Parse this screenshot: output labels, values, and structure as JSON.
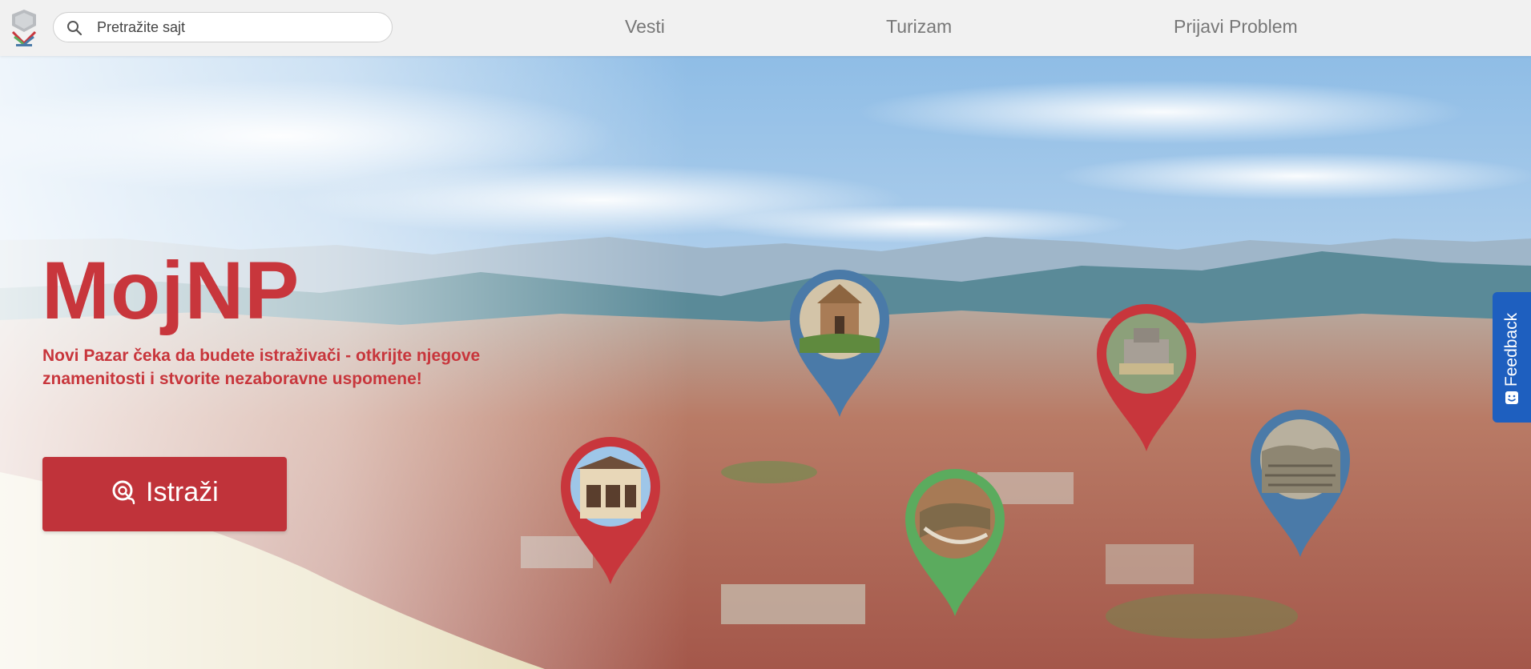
{
  "header": {
    "logo_icon": "municipality-crest-icon",
    "search": {
      "placeholder": "Pretražite sajt",
      "value": "",
      "icon": "search-icon"
    },
    "nav": [
      {
        "label": "Vesti"
      },
      {
        "label": "Turizam"
      },
      {
        "label": "Prijavi Problem"
      }
    ]
  },
  "hero": {
    "title": "MojNP",
    "subtitle": "Novi Pazar čeka da budete istraživači - otkrijte njegove znamenitosti i stvorite nezaboravne uspomene!",
    "cta": {
      "label": "Istraži",
      "icon": "explore-search-icon"
    },
    "map_pins": [
      {
        "id": "church",
        "color": "#4a7aa8"
      },
      {
        "id": "fortress",
        "color": "#c8363c"
      },
      {
        "id": "old-house",
        "color": "#c8363c"
      },
      {
        "id": "canyon",
        "color": "#5bab5e"
      },
      {
        "id": "vintage-photo",
        "color": "#4a7aa8"
      }
    ]
  },
  "feedback": {
    "label": "Feedback",
    "icon": "smile-icon",
    "color": "#1e5fbf"
  },
  "colors": {
    "brand_red": "#c8363c",
    "header_bg": "#f1f1f1",
    "pin_blue": "#4a7aa8",
    "pin_green": "#5bab5e"
  }
}
